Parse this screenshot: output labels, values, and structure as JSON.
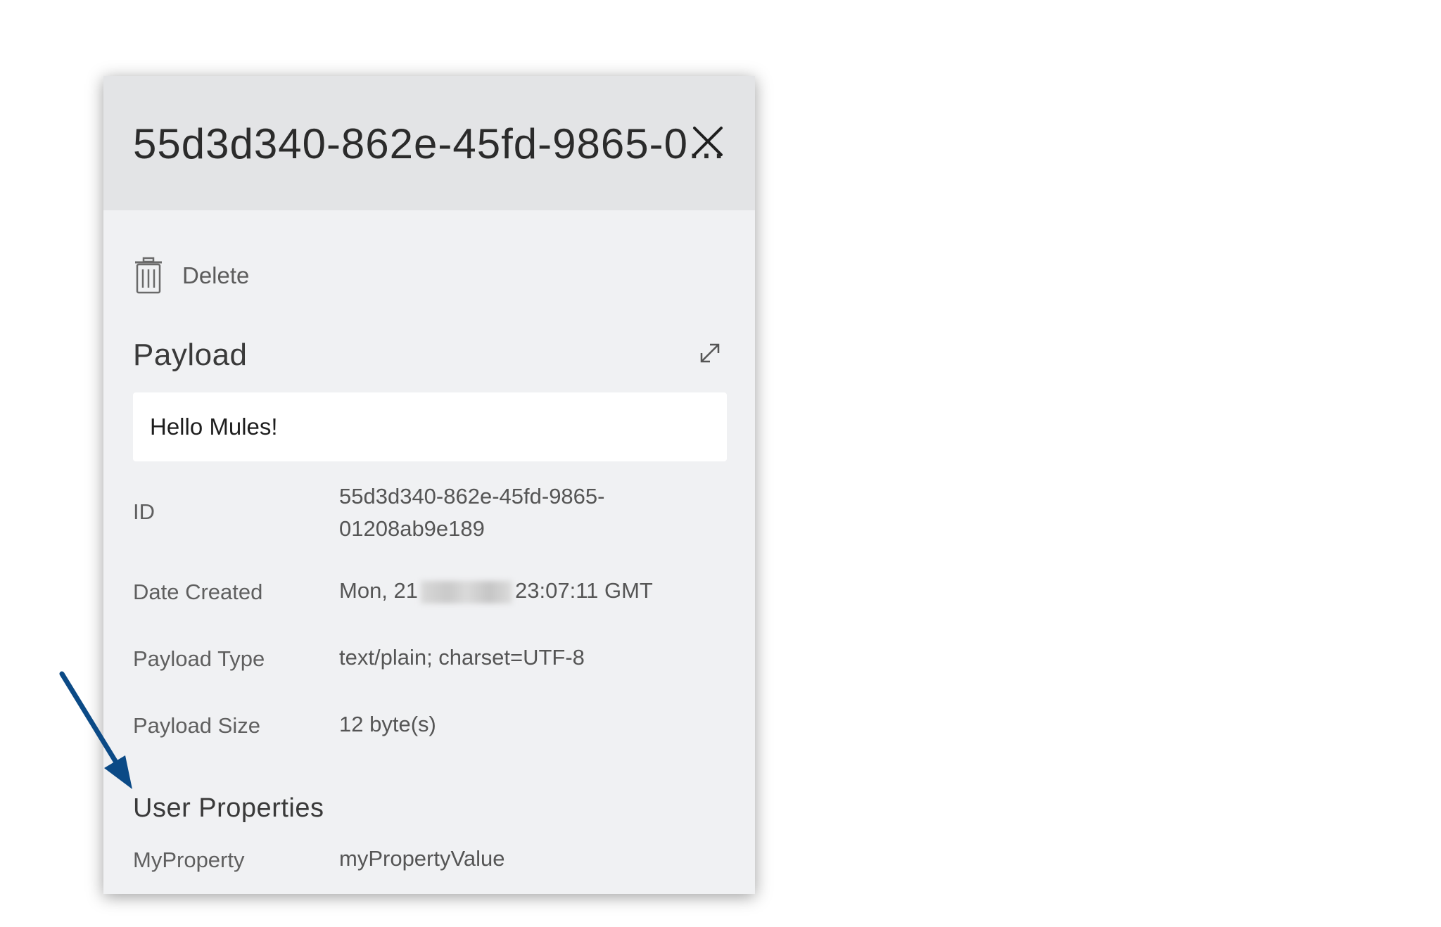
{
  "panel": {
    "title": "55d3d340-862e-45fd-9865-0...",
    "delete_label": "Delete",
    "payload_heading": "Payload",
    "payload_content": "Hello Mules!",
    "details": {
      "id_label": "ID",
      "id_value_line1": "55d3d340-862e-45fd-9865-",
      "id_value_line2": "01208ab9e189",
      "date_label": "Date Created",
      "date_value_prefix": "Mon, 21",
      "date_value_suffix": "23:07:11 GMT",
      "type_label": "Payload Type",
      "type_value": "text/plain; charset=UTF-8",
      "size_label": "Payload Size",
      "size_value": "12 byte(s)"
    },
    "user_properties_heading": "User Properties",
    "user_properties": [
      {
        "name": "MyProperty",
        "value": "myPropertyValue"
      }
    ]
  },
  "icons": {
    "close": "close-icon",
    "delete": "trash-icon",
    "expand": "expand-icon"
  },
  "colors": {
    "panel_bg": "#f0f1f3",
    "header_bg": "#e3e4e6",
    "annotation_arrow": "#0b4a86"
  }
}
